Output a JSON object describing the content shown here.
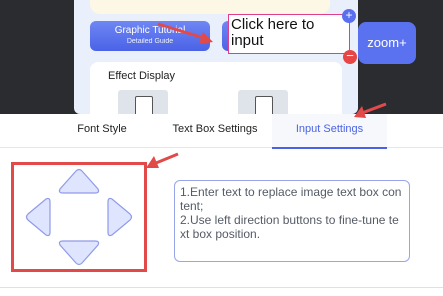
{
  "preview": {
    "tutorial_button": {
      "title": "Graphic Tutorial",
      "subtitle": "Detailed Guide"
    },
    "effect_display_title": "Effect Display",
    "text_box_content": "Click here to input",
    "plus_label": "+",
    "minus_label": "−",
    "zoom_label": "zoom+"
  },
  "tabs": [
    {
      "label": "Font Style"
    },
    {
      "label": "Text Box Settings"
    },
    {
      "label": "Input Settings",
      "active": true
    }
  ],
  "info": {
    "line1": "1.Enter text to replace image text box content;",
    "line2": "2.Use left direction buttons to fine-tune text box position."
  },
  "colors": {
    "accent": "#4a63e6",
    "annotation_red": "#e24a4a",
    "textbox_border": "#e03e8a",
    "dpad_fill": "#dfe5ff"
  },
  "icons": [
    "up-arrow-icon",
    "down-arrow-icon",
    "left-arrow-icon",
    "right-arrow-icon",
    "plus-icon",
    "minus-icon"
  ]
}
